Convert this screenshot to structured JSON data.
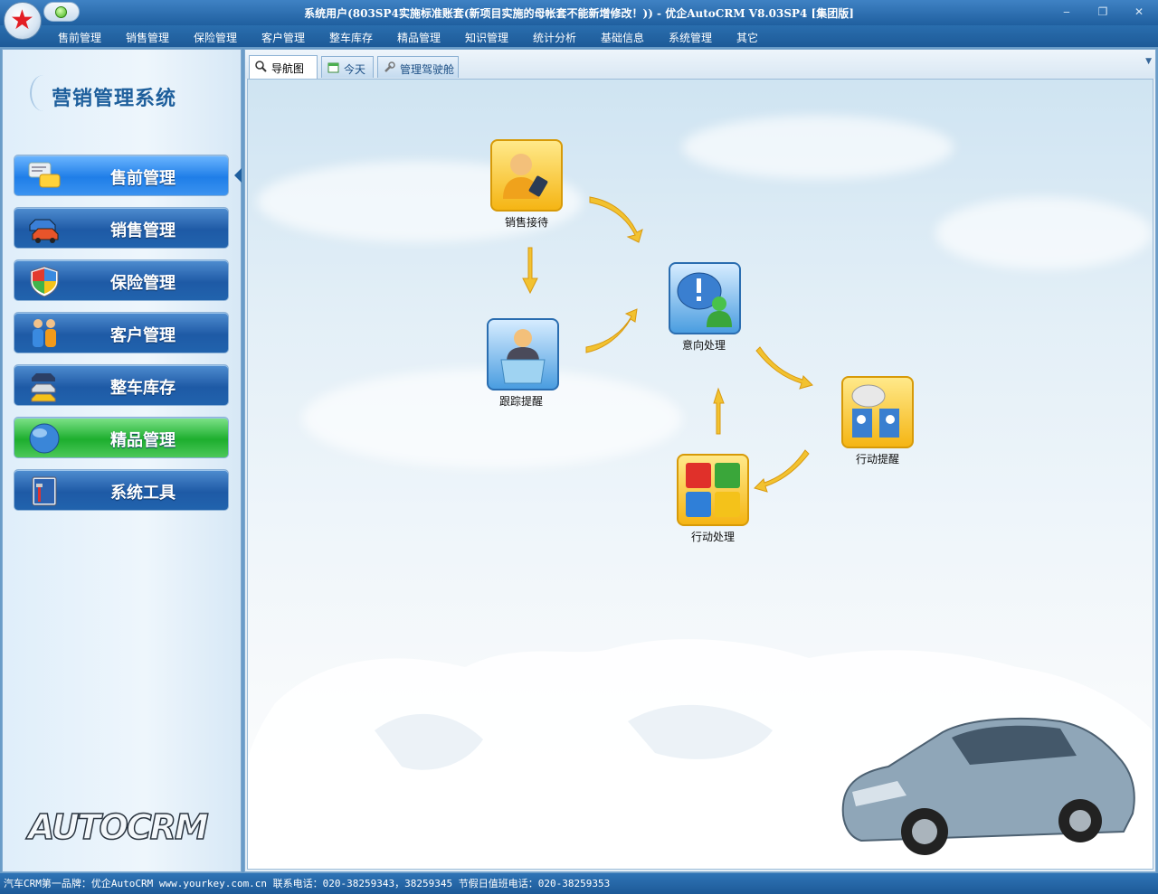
{
  "window": {
    "title": "系统用户(803SP4实施标准账套(新项目实施的母帐套不能新增修改！))  - 优企AutoCRM V8.03SP4 [集团版]",
    "minimize_icon": "minimize-icon",
    "restore_icon": "restore-icon",
    "close_icon": "close-icon"
  },
  "menubar": {
    "items": [
      "售前管理",
      "销售管理",
      "保险管理",
      "客户管理",
      "整车库存",
      "精品管理",
      "知识管理",
      "统计分析",
      "基础信息",
      "系统管理",
      "其它"
    ]
  },
  "sidebar": {
    "title": "营销管理系统",
    "items": [
      {
        "label": "售前管理",
        "icon": "chat-bubbles-icon",
        "state": "active"
      },
      {
        "label": "销售管理",
        "icon": "cars-icon",
        "state": "normal"
      },
      {
        "label": "保险管理",
        "icon": "shield-icon",
        "state": "normal"
      },
      {
        "label": "客户管理",
        "icon": "people-icon",
        "state": "normal"
      },
      {
        "label": "整车库存",
        "icon": "stacked-cars-icon",
        "state": "normal"
      },
      {
        "label": "精品管理",
        "icon": "globe-icon",
        "state": "green"
      },
      {
        "label": "系统工具",
        "icon": "toolbox-icon",
        "state": "normal"
      }
    ],
    "brand": "AUTOCRM"
  },
  "tabs": [
    {
      "label": "导航图",
      "icon": "magnifier-icon",
      "selected": true
    },
    {
      "label": "今天",
      "icon": "calendar-icon",
      "selected": false
    },
    {
      "label": "管理驾驶舱",
      "icon": "wrench-icon",
      "selected": false
    }
  ],
  "flow": {
    "nodes": [
      {
        "label": "销售接待",
        "icon": "reception-person-phone-icon"
      },
      {
        "label": "跟踪提醒",
        "icon": "operator-desk-icon"
      },
      {
        "label": "意向处理",
        "icon": "speech-bubble-user-icon"
      },
      {
        "label": "行动提醒",
        "icon": "chat-people-icon"
      },
      {
        "label": "行动处理",
        "icon": "windows-tiles-icon"
      }
    ]
  },
  "statusbar": {
    "text": "汽车CRM第一品牌：优企AutoCRM  www.yourkey.com.cn   联系电话：020-38259343，38259345   节假日值班电话：020-38259353"
  },
  "colors": {
    "titlebar": "#2a6eae",
    "nav_button": "#1e5aa6",
    "nav_active": "#1f7ee8",
    "nav_green": "#1dae2e",
    "flow_arrow": "#f2c230"
  }
}
